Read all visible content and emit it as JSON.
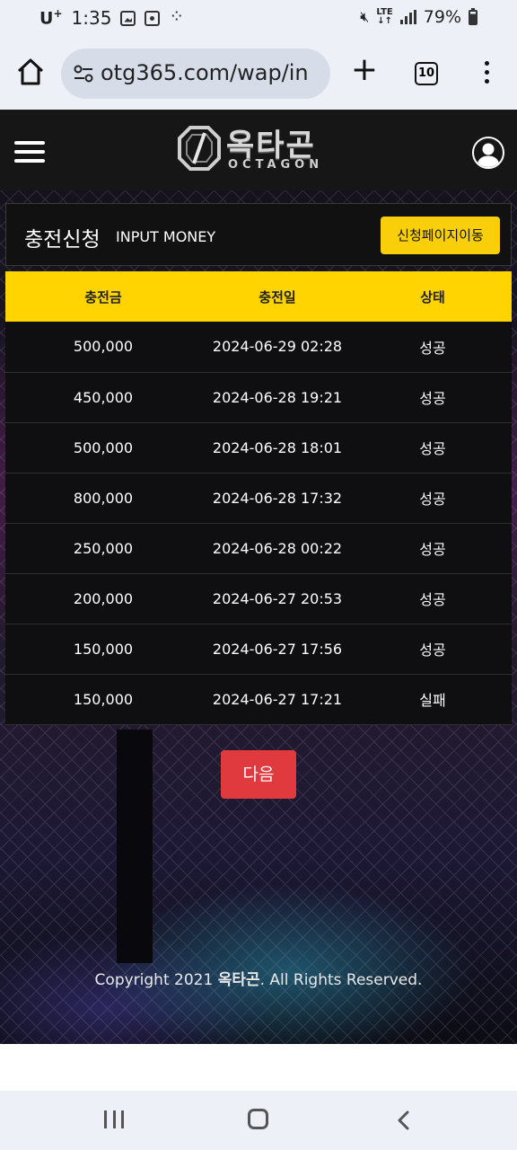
{
  "status_bar": {
    "carrier": "U",
    "carrier_sup": "+",
    "time": "1:35",
    "network": "LTE",
    "battery": "79%"
  },
  "browser": {
    "url": "otg365.com/wap/in",
    "tab_count": "10"
  },
  "site": {
    "logo_ko": "옥타곤",
    "logo_en": "OCTAGON",
    "panel_title": "충전신청",
    "panel_subtitle": "INPUT MONEY",
    "apply_button": "신청페이지이동",
    "table": {
      "headers": [
        "충전금",
        "충전일",
        "상태"
      ],
      "rows": [
        {
          "amount": "500,000",
          "date": "2024-06-29 02:28",
          "status": "성공"
        },
        {
          "amount": "450,000",
          "date": "2024-06-28 19:21",
          "status": "성공"
        },
        {
          "amount": "500,000",
          "date": "2024-06-28 18:01",
          "status": "성공"
        },
        {
          "amount": "800,000",
          "date": "2024-06-28 17:32",
          "status": "성공"
        },
        {
          "amount": "250,000",
          "date": "2024-06-28 00:22",
          "status": "성공"
        },
        {
          "amount": "200,000",
          "date": "2024-06-27 20:53",
          "status": "성공"
        },
        {
          "amount": "150,000",
          "date": "2024-06-27 17:56",
          "status": "성공"
        },
        {
          "amount": "150,000",
          "date": "2024-06-27 17:21",
          "status": "실패"
        }
      ]
    },
    "next_button": "다음",
    "copyright_prefix": "Copyright 2021",
    "copyright_brand": "옥타곤",
    "copyright_suffix": ". All Rights Reserved."
  },
  "colors": {
    "accent_yellow": "#ffd400",
    "next_red": "#e03a3e",
    "header_bg": "#161616"
  }
}
